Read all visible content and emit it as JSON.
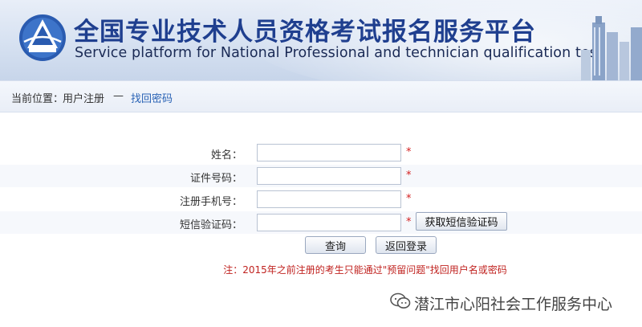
{
  "header": {
    "title_zh": "全国专业技术人员资格考试报名服务平台",
    "title_en": "Service platform for National Professional and technician  qualification test"
  },
  "breadcrumb": {
    "prefix": "当前位置：",
    "item1": "用户注册",
    "separator": "—",
    "item2": "找回密码"
  },
  "form": {
    "fields": [
      {
        "label": "姓名：",
        "value": ""
      },
      {
        "label": "证件号码：",
        "value": ""
      },
      {
        "label": "注册手机号：",
        "value": ""
      },
      {
        "label": "短信验证码：",
        "value": ""
      }
    ],
    "required_mark": "*",
    "sms_button": "获取短信验证码",
    "query_button": "查询",
    "back_button": "返回登录",
    "note": "注：2015年之前注册的考生只能通过\"预留问题\"找回用户名或密码"
  },
  "watermark": {
    "text": "潜江市心阳社会工作服务中心"
  },
  "colors": {
    "title": "#1f3f8f",
    "link": "#2a63b5",
    "required": "#d42020",
    "note": "#c0221f"
  }
}
